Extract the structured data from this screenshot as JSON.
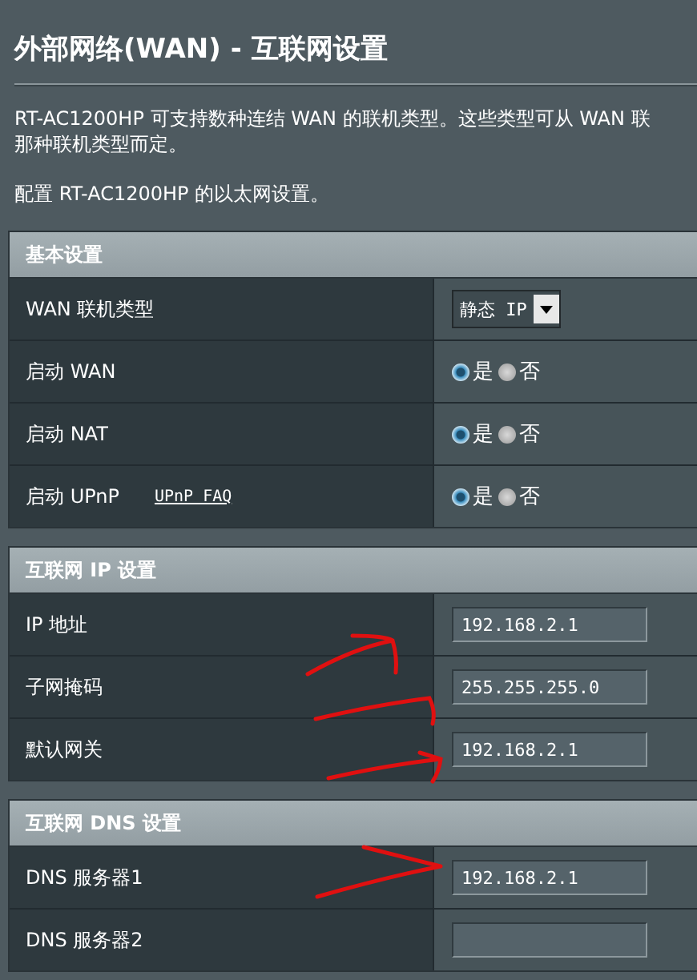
{
  "page_title": "外部网络(WAN) - 互联网设置",
  "description_lines": [
    "RT-AC1200HP 可支持数种连结 WAN 的联机类型。这些类型可从 WAN 联",
    "那种联机类型而定。"
  ],
  "note": "配置 RT-AC1200HP 的以太网设置。",
  "sections": [
    {
      "title": "基本设置",
      "rows": [
        {
          "label": "WAN 联机类型",
          "control": {
            "kind": "select",
            "value": "静态 IP"
          }
        },
        {
          "label": "启动 WAN",
          "control": {
            "kind": "radio",
            "options": [
              {
                "label": "是",
                "selected": true
              },
              {
                "label": "否",
                "selected": false
              }
            ]
          }
        },
        {
          "label": "启动 NAT",
          "control": {
            "kind": "radio",
            "options": [
              {
                "label": "是",
                "selected": true
              },
              {
                "label": "否",
                "selected": false
              }
            ]
          }
        },
        {
          "label": "启动 UPnP",
          "link": "UPnP FAQ",
          "control": {
            "kind": "radio",
            "options": [
              {
                "label": "是",
                "selected": true
              },
              {
                "label": "否",
                "selected": false
              }
            ]
          }
        }
      ]
    },
    {
      "title": "互联网 IP 设置",
      "rows": [
        {
          "label": "IP 地址",
          "control": {
            "kind": "text",
            "value": "192.168.2.1"
          }
        },
        {
          "label": "子网掩码",
          "control": {
            "kind": "text",
            "value": "255.255.255.0"
          }
        },
        {
          "label": "默认网关",
          "control": {
            "kind": "text",
            "value": "192.168.2.1"
          }
        }
      ]
    },
    {
      "title": "互联网 DNS 设置",
      "rows": [
        {
          "label": "DNS 服务器1",
          "control": {
            "kind": "text",
            "value": "192.168.2.1"
          }
        },
        {
          "label": "DNS 服务器2",
          "control": {
            "kind": "text"
          }
        }
      ]
    }
  ]
}
